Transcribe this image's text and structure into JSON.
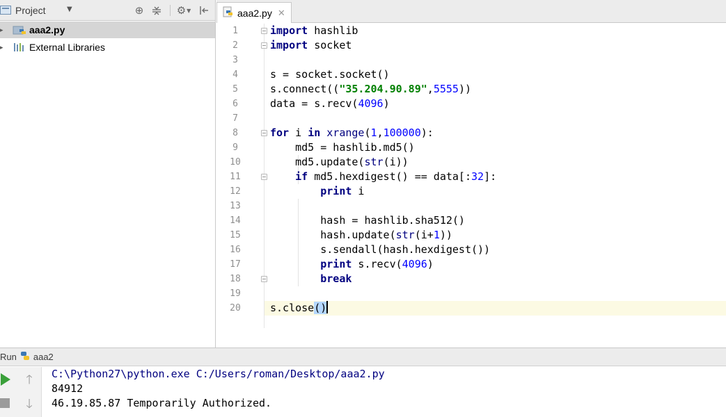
{
  "project_panel": {
    "title": "Project",
    "tree": [
      {
        "label": "aaa2.py"
      },
      {
        "label": "External Libraries"
      }
    ]
  },
  "editor": {
    "tab_label": "aaa2.py",
    "line_numbers": [
      "1",
      "2",
      "3",
      "4",
      "5",
      "6",
      "7",
      "8",
      "9",
      "10",
      "11",
      "12",
      "13",
      "14",
      "15",
      "16",
      "17",
      "18",
      "19",
      "20"
    ],
    "lines": {
      "l1_kw": "import",
      "l1_rest": " hashlib",
      "l2_kw": "import",
      "l2_rest": " socket",
      "l4": "s = socket.socket()",
      "l5_a": "s.connect((",
      "l5_str": "\"35.204.90.89\"",
      "l5_b": ",",
      "l5_num": "5555",
      "l5_c": "))",
      "l6_a": "data = s.recv(",
      "l6_num": "4096",
      "l6_b": ")",
      "l8_kw1": "for",
      "l8_a": " i ",
      "l8_kw2": "in",
      "l8_b": " ",
      "l8_bi": "xrange",
      "l8_c": "(",
      "l8_n1": "1",
      "l8_d": ",",
      "l8_n2": "100000",
      "l8_e": "):",
      "l9": "    md5 = hashlib.md5()",
      "l10_a": "    md5.update(",
      "l10_bi": "str",
      "l10_b": "(i))",
      "l11_a": "    ",
      "l11_kw": "if",
      "l11_b": " md5.hexdigest() == data[:",
      "l11_num": "32",
      "l11_c": "]:",
      "l12_a": "        ",
      "l12_kw": "print",
      "l12_b": " i",
      "l14": "        hash = hashlib.sha512()",
      "l15_a": "        hash.update(",
      "l15_bi": "str",
      "l15_b": "(i+",
      "l15_num": "1",
      "l15_c": "))",
      "l16": "        s.sendall(hash.hexdigest())",
      "l17_a": "        ",
      "l17_kw": "print",
      "l17_b": " s.recv(",
      "l17_num": "4096",
      "l17_c": ")",
      "l18_a": "        ",
      "l18_kw": "break",
      "l20_a": "s.close",
      "l20_hl": "()"
    }
  },
  "run_panel": {
    "title": "Run",
    "config": "aaa2",
    "console": [
      "C:\\Python27\\python.exe C:/Users/roman/Desktop/aaa2.py",
      "84912",
      "46.19.85.87 Temporarily Authorized."
    ]
  },
  "colors": {
    "keyword": "#000080",
    "number": "#0000ff",
    "string": "#008000",
    "selection": "#b4d7ff",
    "current_line": "#fcfae3"
  }
}
